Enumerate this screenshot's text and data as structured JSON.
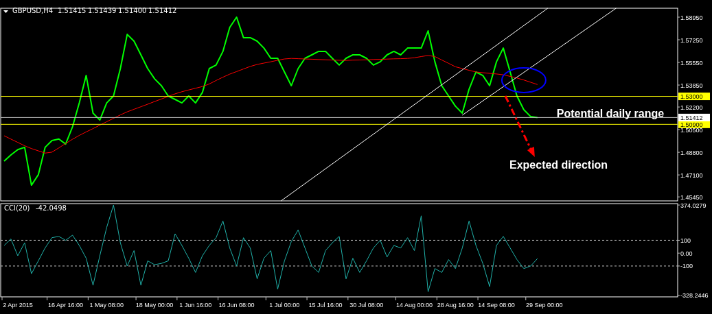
{
  "chart": {
    "quotes": [
      "1.51415",
      "1.51439",
      "1.51400",
      "1.51412"
    ],
    "chart_data": {
      "type": "line",
      "series": [
        {
          "name": "GBPUSD,H4",
          "color": "#00ff00",
          "values": [
            1.4814,
            1.486,
            1.49,
            1.4917,
            1.4633,
            1.4711,
            1.4917,
            1.4968,
            1.498,
            1.4942,
            1.5071,
            1.5251,
            1.5457,
            1.5174,
            1.5122,
            1.5251,
            1.5303,
            1.5509,
            1.5766,
            1.5715,
            1.5612,
            1.5509,
            1.5432,
            1.538,
            1.5303,
            1.5277,
            1.5251,
            1.5303,
            1.5251,
            1.5329,
            1.5509,
            1.5535,
            1.5638,
            1.5818,
            1.5895,
            1.5741,
            1.5741,
            1.5715,
            1.5663,
            1.5586,
            1.5586,
            1.5483,
            1.538,
            1.5509,
            1.5586,
            1.5612,
            1.5638,
            1.5638,
            1.5586,
            1.5535,
            1.5586,
            1.5612,
            1.5612,
            1.5586,
            1.5535,
            1.556,
            1.5612,
            1.5638,
            1.5612,
            1.5663,
            1.5663,
            1.5663,
            1.5792,
            1.556,
            1.538,
            1.5303,
            1.5226,
            1.5174,
            1.5354,
            1.5483,
            1.5457,
            1.538,
            1.556,
            1.5663,
            1.5483,
            1.5303,
            1.52,
            1.5148,
            1.5141
          ]
        },
        {
          "color": "#ff0000",
          "values": [
            1.5004,
            1.4979,
            1.4954,
            1.4929,
            1.4908,
            1.4891,
            1.4874,
            1.4881,
            1.4913,
            1.4946,
            1.4978,
            1.5007,
            1.5033,
            1.5058,
            1.5084,
            1.511,
            1.5135,
            1.5161,
            1.5184,
            1.5203,
            1.5222,
            1.5241,
            1.5261,
            1.528,
            1.53,
            1.5319,
            1.5335,
            1.5348,
            1.5361,
            1.5374,
            1.5393,
            1.5419,
            1.5444,
            1.5467,
            1.5486,
            1.5506,
            1.5525,
            1.554,
            1.555,
            1.556,
            1.5571,
            1.5581,
            1.5585,
            1.5583,
            1.5581,
            1.5579,
            1.5577,
            1.5575,
            1.5573,
            1.5571,
            1.557,
            1.5572,
            1.5573,
            1.5575,
            1.5577,
            1.5578,
            1.558,
            1.5582,
            1.5583,
            1.5585,
            1.559,
            1.5599,
            1.5607,
            1.5599,
            1.5573,
            1.5548,
            1.5522,
            1.5509,
            1.5496,
            1.5483,
            1.5478,
            1.5473,
            1.5468,
            1.5462,
            1.545,
            1.5438,
            1.5423,
            1.5406,
            1.5389
          ]
        }
      ],
      "ylim": [
        1.4515,
        1.5962
      ],
      "yticks": [
        {
          "value": 1.5895,
          "label": "1.58950"
        },
        {
          "value": 1.5725,
          "label": "1.57250"
        },
        {
          "value": 1.5555,
          "label": "1.55550"
        },
        {
          "value": 1.5385,
          "label": "1.53850"
        },
        {
          "value": 1.522,
          "label": "1.52200"
        },
        {
          "value": 1.505,
          "label": "1.50500"
        },
        {
          "value": 1.488,
          "label": "1.48800"
        },
        {
          "value": 1.471,
          "label": "1.47100"
        },
        {
          "value": 1.4545,
          "label": "1.45450"
        }
      ],
      "ref_lines": [
        {
          "axis": "y",
          "value": 1.53,
          "color": "#ffff00",
          "label": "1.53000"
        },
        {
          "axis": "y",
          "value": 1.509,
          "color": "#ffff00",
          "label": "1.50900"
        },
        {
          "axis": "y",
          "value": 1.51412,
          "color": "#c0c0c0",
          "label": "1.51412"
        }
      ],
      "annotations": [
        "Potential daily range",
        "Expected direction"
      ]
    }
  },
  "indicator": {
    "value": "-42.0498",
    "chart_data": {
      "type": "line",
      "categories": [
        null,
        null,
        "2 Apr 2015",
        null,
        null,
        null,
        null,
        null,
        null,
        "16 Apr 16:00",
        null,
        null,
        null,
        null,
        null,
        "1 May 08:00",
        null,
        null,
        null,
        null,
        null,
        null,
        "18 May 00:00",
        null,
        null,
        null,
        null,
        null,
        "1 Jun 16:00",
        null,
        null,
        null,
        null,
        null,
        "16 Jun 08:00",
        null,
        null,
        null,
        null,
        null,
        null,
        "1 Jul 00:00",
        null,
        null,
        null,
        null,
        null,
        "15 Jul 16:00",
        null,
        null,
        null,
        null,
        null,
        "30 Jul 08:00",
        null,
        null,
        null,
        null,
        null,
        null,
        "14 Aug 00:00",
        null,
        null,
        null,
        null,
        null,
        "28 Aug 16:00",
        null,
        null,
        null,
        null,
        null,
        "14 Sep 08:00",
        null,
        null,
        null,
        null,
        null,
        null,
        "29 Sep 00:00"
      ],
      "series": [
        {
          "name": "CCI(20)",
          "color": "#20b2aa",
          "values": [
            60,
            110,
            -20,
            80,
            -160,
            -60,
            40,
            120,
            130,
            100,
            140,
            60,
            -40,
            -250,
            -20,
            200,
            374,
            80,
            -100,
            20,
            -250,
            -60,
            -90,
            -80,
            -60,
            150,
            60,
            -40,
            -150,
            -20,
            60,
            120,
            250,
            40,
            -100,
            120,
            40,
            -200,
            -40,
            20,
            -280,
            -60,
            90,
            180,
            40,
            -100,
            -150,
            20,
            80,
            130,
            -200,
            -40,
            -150,
            -60,
            40,
            100,
            -30,
            60,
            40,
            120,
            20,
            290,
            -300,
            -120,
            -150,
            -50,
            -120,
            40,
            250,
            60,
            -80,
            -260,
            60,
            130,
            40,
            -50,
            -120,
            -100,
            -42,
            null
          ]
        }
      ],
      "ylim": [
        -340,
        385
      ],
      "yticks": [
        {
          "value": 374.0279,
          "label": "374.0279"
        },
        {
          "value": 100,
          "label": "100"
        },
        {
          "value": 0,
          "label": "0.00"
        },
        {
          "value": -100,
          "label": "-100"
        },
        {
          "value": -328.2446,
          "label": "-328.2446"
        }
      ],
      "ref_lines": [
        {
          "axis": "y",
          "value": 100
        },
        {
          "axis": "y",
          "value": -100
        }
      ]
    }
  }
}
